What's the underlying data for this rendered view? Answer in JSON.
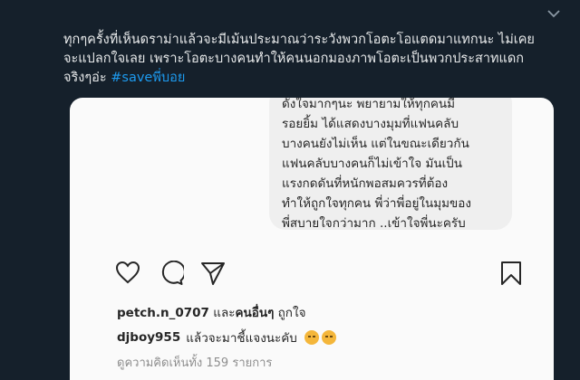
{
  "tweet": {
    "lines": [
      "ทุกๆครั้งที่เห็นดราม่าแล้วจะมีเม้นประมาณว่าระวังพวกโอตะโอแตดมาแทกนะ ไม่เคย",
      "จะแปลกใจเลย เพราะโอตะบางคนทำให้คนนอกมองภาพโอตะเป็นพวกประสาทแดก"
    ],
    "last_line_prefix": "จริงๆอ่ะ ",
    "hashtag": "#saveพี่บอย"
  },
  "post": {
    "message_lines": [
      "ดังใจมากๆนะ พยายามให้ทุกคนมี",
      "รอยยิ้ม ได้แสดงบางมุมที่แฟนคลับ",
      "บางคนยังไม่เห็น แต่ในขณะเดียวกัน",
      "แฟนคลับบางคนก็ไม่เข้าใจ มันเป็น",
      "แรงกดดันที่หนักพอสมควรที่ต้อง",
      "ทำให้ถูกใจทุกคน พี่ว่าพี่อยู่ในมุมของ",
      "พี่สบายใจกว่ามาก ..เข้าใจพี่นะครับ"
    ],
    "likes": {
      "username": "petch.n_0707",
      "middle": " และ",
      "others": "คนอื่นๆ",
      "suffix": " ถูกใจ"
    },
    "comment": {
      "username": "djboy955",
      "text": "แล้วจะมาชี้แจงนะคับ"
    },
    "view_all": "ดูความคิดเห็นทั้ง 159 รายการ"
  },
  "icons": {
    "like": "heart-icon",
    "comment": "comment-icon",
    "share": "send-icon",
    "save": "bookmark-icon",
    "more": "chevron-down-icon"
  },
  "colors": {
    "background": "#15202b",
    "text": "#e7e9ea",
    "hashtag": "#1d9bf0"
  }
}
